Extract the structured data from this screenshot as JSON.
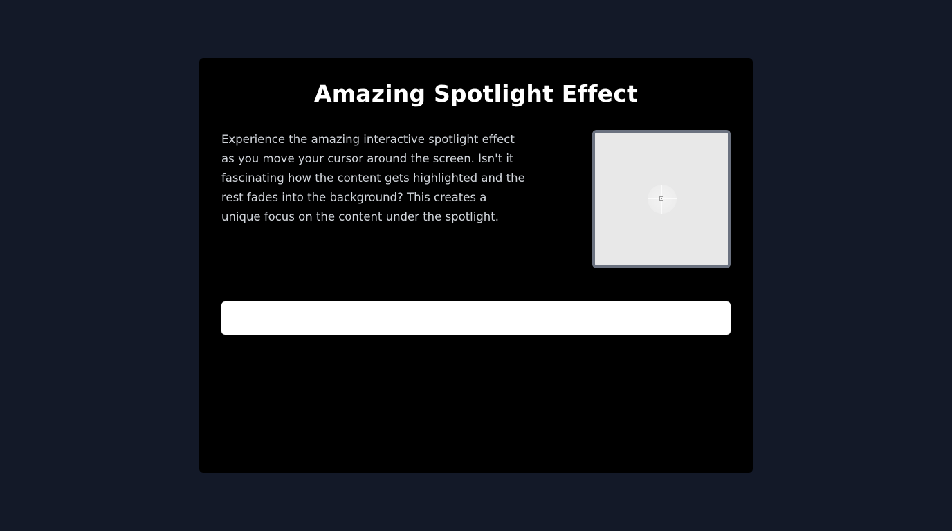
{
  "page": {
    "background": "#131928",
    "card_background": "#000000",
    "title": "Amazing Spotlight Effect",
    "description": "Experience the amazing interactive spotlight effect as you move your cursor around the screen. Isn't it fascinating how the content gets highlighted and the rest fades into the background? This creates a unique focus on the content under the spotlight."
  },
  "image_box": {
    "border_color": "#6b7280",
    "fill_color": "#e8e8e8",
    "icon": "broken-image-icon"
  },
  "input": {
    "value": "",
    "placeholder": ""
  }
}
